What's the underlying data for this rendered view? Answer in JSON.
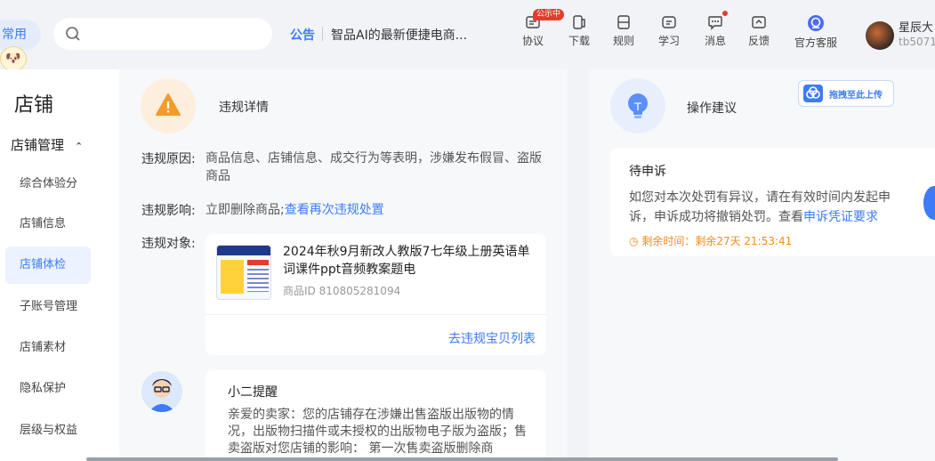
{
  "topbar": {
    "frequent_label": "常用",
    "search_placeholder": "",
    "notice_tag": "公告",
    "notice_text": "智品AI的最新便捷电商...",
    "tools": [
      {
        "label": "协议",
        "badge": "公示中",
        "icon": "agreement-icon"
      },
      {
        "label": "下载",
        "icon": "download-icon"
      },
      {
        "label": "规则",
        "icon": "rules-icon"
      },
      {
        "label": "学习",
        "icon": "learn-icon"
      },
      {
        "label": "消息",
        "icon": "message-icon",
        "dot": true
      },
      {
        "label": "反馈",
        "icon": "feedback-icon"
      },
      {
        "label": "官方客服",
        "icon": "customer-service-icon"
      }
    ],
    "user_name": "星辰大",
    "user_id": "tb5071"
  },
  "sidebar": {
    "title": "店铺",
    "group": "店铺管理",
    "items": [
      {
        "label": "综合体验分"
      },
      {
        "label": "店铺信息"
      },
      {
        "label": "店铺体检",
        "active": true
      },
      {
        "label": "子账号管理"
      },
      {
        "label": "店铺素材"
      },
      {
        "label": "隐私保护"
      },
      {
        "label": "层级与权益"
      }
    ]
  },
  "violation": {
    "title": "违规详情",
    "reason_label": "违规原因:",
    "reason_text": "商品信息、店铺信息、成交行为等表明，涉嫌发布假冒、盗版商品",
    "impact_label": "违规影响:",
    "impact_text": "立即删除商品;",
    "impact_link": "查看再次违规处置",
    "target_label": "违规对象:",
    "product_title": "2024年秋9月新改人教版7七年级上册英语单词课件ppt音频教案题电",
    "product_id": "商品ID 810805281094",
    "product_link": "去违规宝贝列表"
  },
  "reminder": {
    "title": "小二提醒",
    "text": "亲爱的卖家：您的店铺存在涉嫌出售盗版出版物的情况，出版物扫描件或未授权的出版物电子版为盗版；售卖盗版对您店铺的影响： 第一次售卖盗版删除商"
  },
  "suggestion": {
    "title": "操作建议",
    "upload_label": "拖拽至此上传",
    "appeal_title": "待申诉",
    "appeal_text": "如您对本次处罚有异议，请在有效时间内发起申诉，申诉成功将撤销处罚。查看",
    "appeal_link": "申诉凭证要求",
    "remaining_time": "剩余时间：剩余27天 21:53:41"
  },
  "colors": {
    "accent": "#3d7bf7",
    "warning": "#f39a28",
    "timer": "#f08c1a",
    "badge": "#e33d2e"
  }
}
